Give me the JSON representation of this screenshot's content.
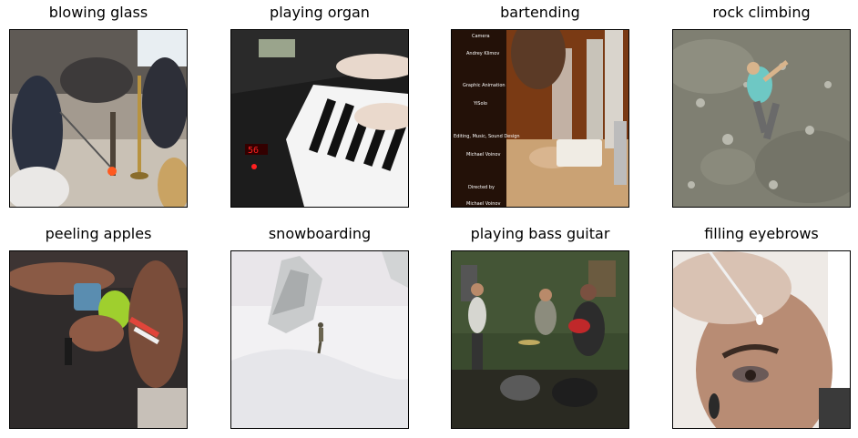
{
  "panels": [
    {
      "label": "blowing glass"
    },
    {
      "label": "playing organ"
    },
    {
      "label": "bartending",
      "overlay_credits": [
        "Camera",
        "Andrey Klimov",
        "Graphic Animation",
        "YiSolo",
        "Editing, Music, Sound Design",
        "Michael Voinov",
        "Directed by",
        "Michael Voinov"
      ]
    },
    {
      "label": "rock climbing"
    },
    {
      "label": "peeling apples"
    },
    {
      "label": "snowboarding"
    },
    {
      "label": "playing bass guitar"
    },
    {
      "label": "filling eyebrows"
    }
  ]
}
